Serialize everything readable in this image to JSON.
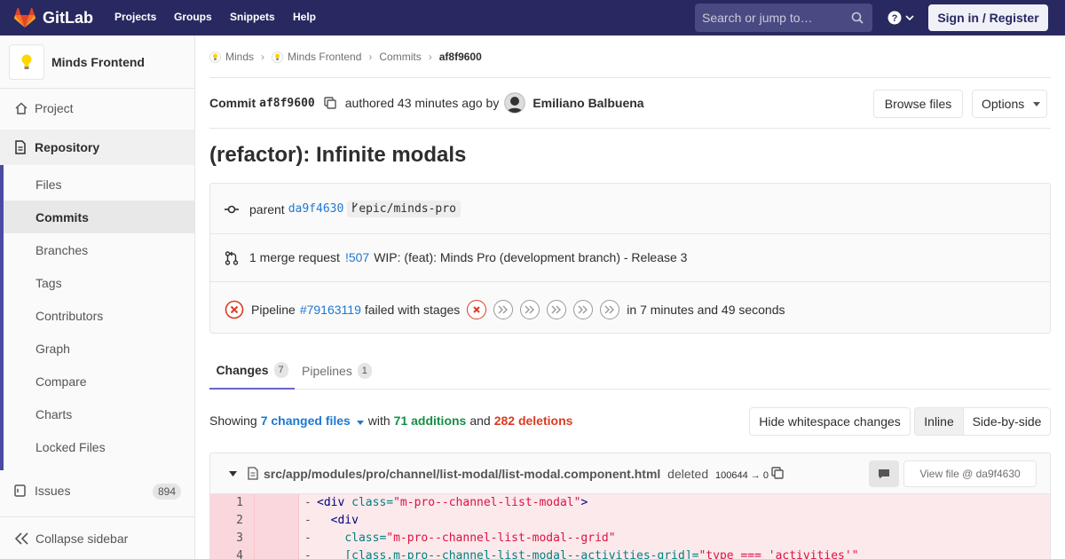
{
  "navbar": {
    "brand": "GitLab",
    "links": [
      "Projects",
      "Groups",
      "Snippets",
      "Help"
    ],
    "search_placeholder": "Search or jump to…",
    "signin_label": "Sign in / Register"
  },
  "sidebar": {
    "project_name": "Minds Frontend",
    "project_label": "Project",
    "repository_label": "Repository",
    "repo_items": [
      "Files",
      "Commits",
      "Branches",
      "Tags",
      "Contributors",
      "Graph",
      "Compare",
      "Charts",
      "Locked Files"
    ],
    "issues_label": "Issues",
    "issues_count": "894",
    "collapse_label": "Collapse sidebar"
  },
  "breadcrumb": [
    "Minds",
    "Minds Frontend",
    "Commits",
    "af8f9600"
  ],
  "commit": {
    "prefix": "Commit",
    "sha": "af8f9600",
    "authored": "authored 43 minutes ago by",
    "author": "Emiliano Balbuena",
    "browse_files": "Browse files",
    "options": "Options",
    "title": "(refactor): Infinite modals"
  },
  "info": {
    "parent_label": "parent",
    "parent_sha": "da9f4630",
    "branch": "epic/minds-pro",
    "mr_text": "1 merge request",
    "mr_id": "!507",
    "mr_title": "WIP: (feat): Minds Pro (development branch) - Release 3",
    "pipeline_label": "Pipeline",
    "pipeline_id": "#79163119",
    "pipeline_status": "failed with stages",
    "pipeline_duration": "in 7 minutes and 49 seconds"
  },
  "tabs": [
    {
      "label": "Changes",
      "count": "7"
    },
    {
      "label": "Pipelines",
      "count": "1"
    }
  ],
  "showing": {
    "prefix": "Showing",
    "files": "7 changed files",
    "with": "with",
    "additions": "71 additions",
    "and": "and",
    "deletions": "282 deletions",
    "hide_whitespace": "Hide whitespace changes",
    "inline": "Inline",
    "side_by_side": "Side-by-side"
  },
  "file": {
    "path": "src/app/modules/pro/channel/list-modal/list-modal.component.html",
    "status": "deleted",
    "mode": "100644 → 0",
    "view_file": "View file @ da9f4630"
  },
  "diff": {
    "line_numbers": [
      "1",
      "2",
      "3",
      "4"
    ],
    "sign": "-"
  },
  "colors": {
    "navbar": "#292961",
    "link": "#1f78d1",
    "additions": "#168f48",
    "deletions": "#db3b21",
    "deleted_line_bg": "#fbe9eb"
  }
}
